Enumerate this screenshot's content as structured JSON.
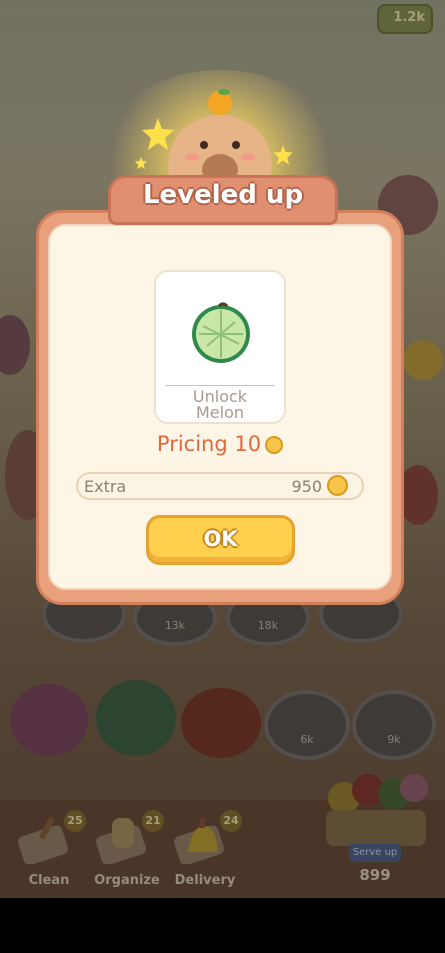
{
  "hud": {
    "coins": "1.2k"
  },
  "dialog": {
    "title": "Leveled up",
    "unlock_label_line1": "Unlock",
    "unlock_label_line2": "Melon",
    "pricing_text": "Pricing 10",
    "extra_label": "Extra",
    "extra_value": "950",
    "ok_label": "OK"
  },
  "background": {
    "plate_labels": [
      "13k",
      "18k",
      "6k",
      "9k"
    ]
  },
  "tools": [
    {
      "label": "Clean",
      "badge": "25"
    },
    {
      "label": "Organize",
      "badge": "21"
    },
    {
      "label": "Delivery",
      "badge": "24"
    }
  ],
  "basket": {
    "button_label": "Serve up",
    "count": "899"
  },
  "colors": {
    "dialog_frame": "#e8a17c",
    "ok_button": "#ffcf4e",
    "pricing_text": "#e06a3c"
  },
  "icons": [
    "capybara-mascot",
    "star-icon",
    "melon-icon",
    "coin-icon",
    "broom-icon",
    "glove-icon",
    "bell-icon"
  ]
}
